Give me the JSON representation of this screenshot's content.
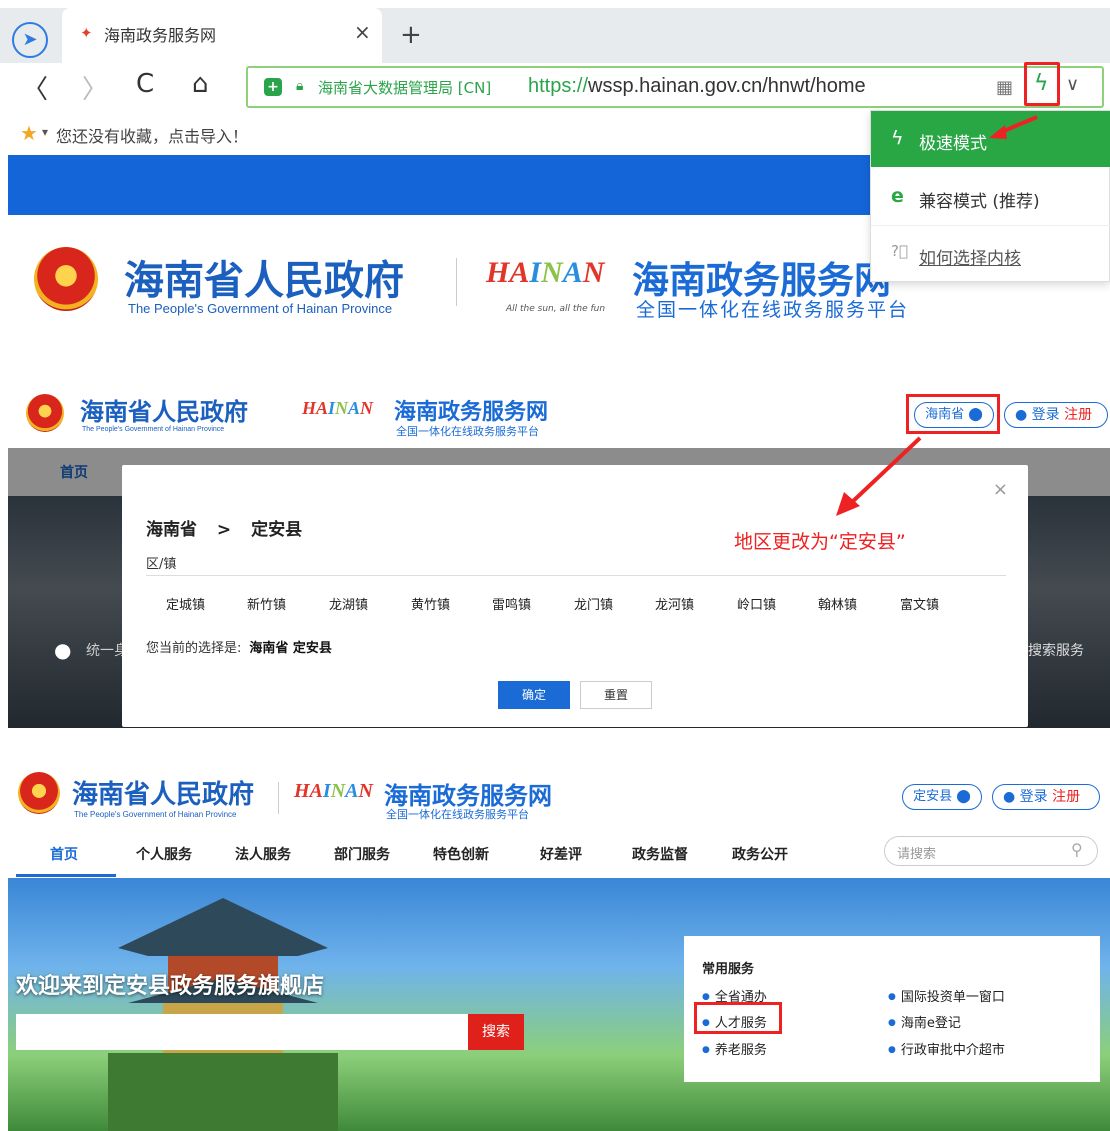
{
  "browser": {
    "tab_title": "海南政务服务网",
    "tab_close": "×",
    "new_tab": "+",
    "back": "〈",
    "forward": "〉",
    "reload": "C",
    "home": "⌂",
    "cert_label": "海南省大数据管理局 [CN]",
    "url_proto": "https://",
    "url_host": "wssp.hainan.gov.cn",
    "url_path": "/hnwt/home",
    "bookmark_hint": "您还没有收藏，点击导入！",
    "kernel_menu": {
      "fast": "极速模式",
      "compat": "兼容模式 (推荐)",
      "how": "如何选择内核"
    }
  },
  "site": {
    "gov_cn": "海南省人民政府",
    "gov_en": "The People's Government of Hainan Province",
    "hainan_logo": "HAINAN",
    "hainan_slogan": "All the sun, all the fun",
    "portal_cn": "海南政务服务网",
    "portal_sub": "全国一体化在线政务服务平台",
    "login": "登录",
    "register": "注册",
    "menu": [
      "首页",
      "个人服务",
      "法人服务",
      "部门服务",
      "特色创新",
      "好差评",
      "政务监督",
      "政务公开"
    ]
  },
  "panel2": {
    "region": "海南省",
    "path_province": "海南省",
    "path_sep": ">",
    "path_county": "定安县",
    "section": "区/镇",
    "towns": [
      "定城镇",
      "新竹镇",
      "龙湖镇",
      "黄竹镇",
      "雷鸣镇",
      "龙门镇",
      "龙河镇",
      "岭口镇",
      "翰林镇",
      "富文镇"
    ],
    "current_label": "您当前的选择是:",
    "current_value": "海南省 定安县",
    "ok": "确定",
    "reset": "重置",
    "close": "×",
    "bg_left": "统一身",
    "bg_right": "搜索服务",
    "annotation": "地区更改为“定安县”"
  },
  "panel3": {
    "region": "定安县",
    "search_placeholder": "请搜索",
    "welcome": "欢迎来到定安县政务服务旗舰店",
    "search_btn": "搜索",
    "services_title": "常用服务",
    "services_left": [
      "全省通办",
      "人才服务",
      "养老服务"
    ],
    "services_right": [
      "国际投资单一窗口",
      "海南e登记",
      "行政审批中介超市"
    ]
  },
  "colors": {
    "brand_blue": "#1b6bd6",
    "fast_green": "#29a745",
    "annot_red": "#e22222"
  }
}
